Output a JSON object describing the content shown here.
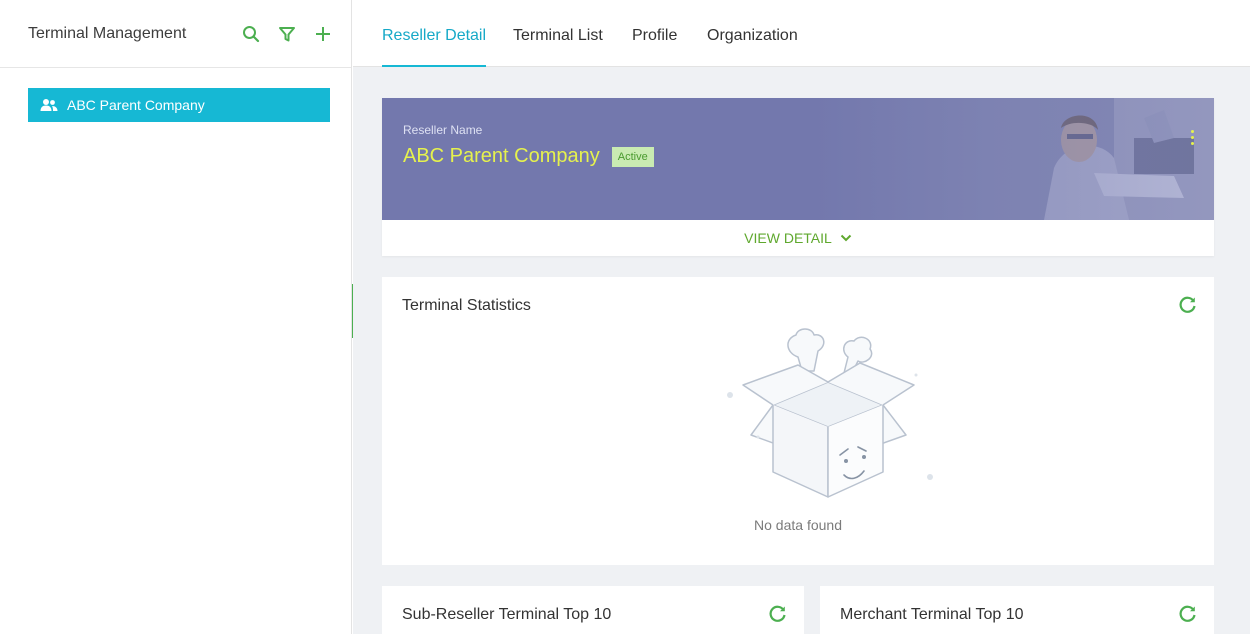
{
  "left_panel": {
    "title": "Terminal Management",
    "tools": [
      "search-icon",
      "filter-icon",
      "plus-icon"
    ],
    "tree": [
      {
        "label": "ABC Parent Company",
        "icon": "users-icon",
        "selected": true
      }
    ]
  },
  "tabs": [
    {
      "label": "Reseller Detail",
      "active": true
    },
    {
      "label": "Terminal List",
      "active": false
    },
    {
      "label": "Profile",
      "active": false
    },
    {
      "label": "Organization",
      "active": false
    }
  ],
  "reseller": {
    "label": "Reseller Name",
    "name": "ABC Parent Company",
    "status": "Active",
    "view_detail": "VIEW DETAIL"
  },
  "stats": {
    "title": "Terminal Statistics",
    "empty_text": "No data found"
  },
  "bottom_cards": [
    {
      "title": "Sub-Reseller Terminal Top 10"
    },
    {
      "title": "Merchant Terminal Top 10"
    }
  ],
  "colors": {
    "accent": "#16b8d4",
    "green": "#4caf50",
    "banner": "#7378ad",
    "name_yellow": "#e6f24d",
    "badge_bg": "#c9ebb2"
  }
}
